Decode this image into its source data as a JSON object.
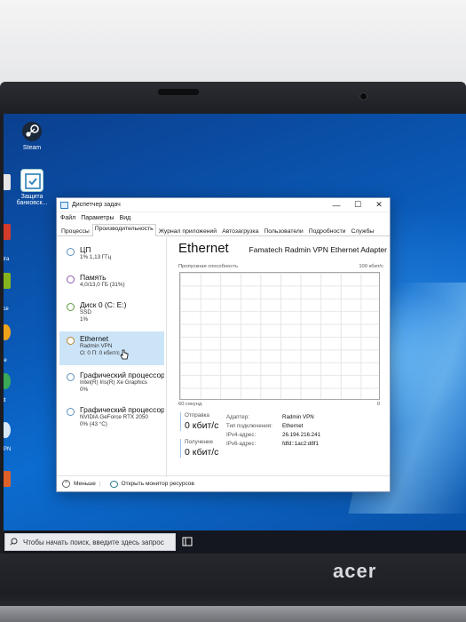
{
  "desktop": {
    "icons": [
      {
        "label": "Steam",
        "icon": "steam-icon"
      },
      {
        "label": "Защита банковск...",
        "icon": "bank-protection-icon"
      }
    ],
    "edge_fragments": [
      "е",
      "ntra",
      "ace",
      "ice",
      "ott",
      "VPN"
    ]
  },
  "task_manager": {
    "title": "Диспетчер задач",
    "window_buttons": {
      "minimize": "—",
      "maximize": "☐",
      "close": "✕"
    },
    "menu": [
      "Файл",
      "Параметры",
      "Вид"
    ],
    "tabs": [
      "Процессы",
      "Производительность",
      "Журнал приложений",
      "Автозагрузка",
      "Пользователи",
      "Подробности",
      "Службы"
    ],
    "active_tab": "Производительность",
    "resources": [
      {
        "name": "ЦП",
        "sub1": "1% 1,13 ГГц",
        "sub2": ""
      },
      {
        "name": "Память",
        "sub1": "4,0/13,0 ГБ (31%)",
        "sub2": ""
      },
      {
        "name": "Диск 0 (C: E:)",
        "sub1": "SSD",
        "sub2": "1%"
      },
      {
        "name": "Ethernet",
        "sub1": "Radmin VPN",
        "sub2": "О: 0 П: 0 кбит/с"
      },
      {
        "name": "Графический процессор 0",
        "sub1": "Intel(R) Iris(R) Xe Graphics",
        "sub2": "0%"
      },
      {
        "name": "Графический процессор 1",
        "sub1": "NVIDIA GeForce RTX 2050",
        "sub2": "0% (43 °C)"
      }
    ],
    "selected_resource": "Ethernet",
    "detail": {
      "title": "Ethernet",
      "adapter": "Famatech Radmin VPN Ethernet Adapter",
      "capacity_label": "Пропускная способность",
      "capacity_max": "100 кбит/с",
      "time_label": "60 секунд",
      "time_zero": "0",
      "send_label": "Отправка",
      "send_value": "0 кбит/с",
      "receive_label": "Получение",
      "receive_value": "0 кбит/с",
      "properties": [
        {
          "key": "Адаптер:",
          "value": "Radmin VPN"
        },
        {
          "key": "Тип подключения:",
          "value": "Ethernet"
        },
        {
          "key": "IPv4-адрес:",
          "value": "26.194.216.241"
        },
        {
          "key": "IPv6-адрес:",
          "value": "fdfd::1ac2:d8f1"
        }
      ]
    },
    "footer": {
      "less_label": "Меньше",
      "monitor_label": "Открыть монитор ресурсов"
    }
  },
  "taskbar": {
    "search_placeholder": "Чтобы начать поиск, введите здесь запрос"
  },
  "laptop": {
    "brand": "acer"
  },
  "colors": {
    "desktop_blue": "#0a5ab8",
    "selection": "#cce4f7",
    "taskbar": "#141720"
  }
}
